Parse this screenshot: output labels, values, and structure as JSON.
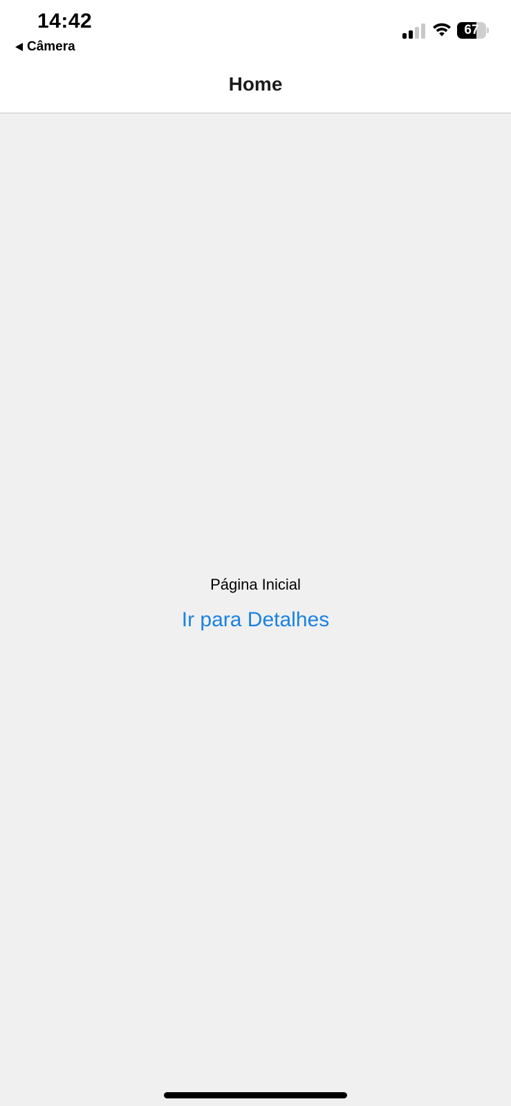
{
  "status_bar": {
    "time": "14:42",
    "back_app_label": "Câmera",
    "battery_level": "67",
    "battery_fraction": 0.67,
    "signal_bars_active": 2,
    "signal_bars_total": 4,
    "icons": [
      "back-triangle-icon",
      "signal-icon",
      "wifi-icon",
      "battery-icon"
    ]
  },
  "header": {
    "title": "Home"
  },
  "main": {
    "page_label": "Página Inicial",
    "details_link": "Ir para Detalhes"
  },
  "colors": {
    "link": "#1a82e2",
    "background": "#f0f0f0",
    "header_background": "#ffffff",
    "signal_active": "#000000",
    "signal_inactive": "#c8c8c8"
  }
}
